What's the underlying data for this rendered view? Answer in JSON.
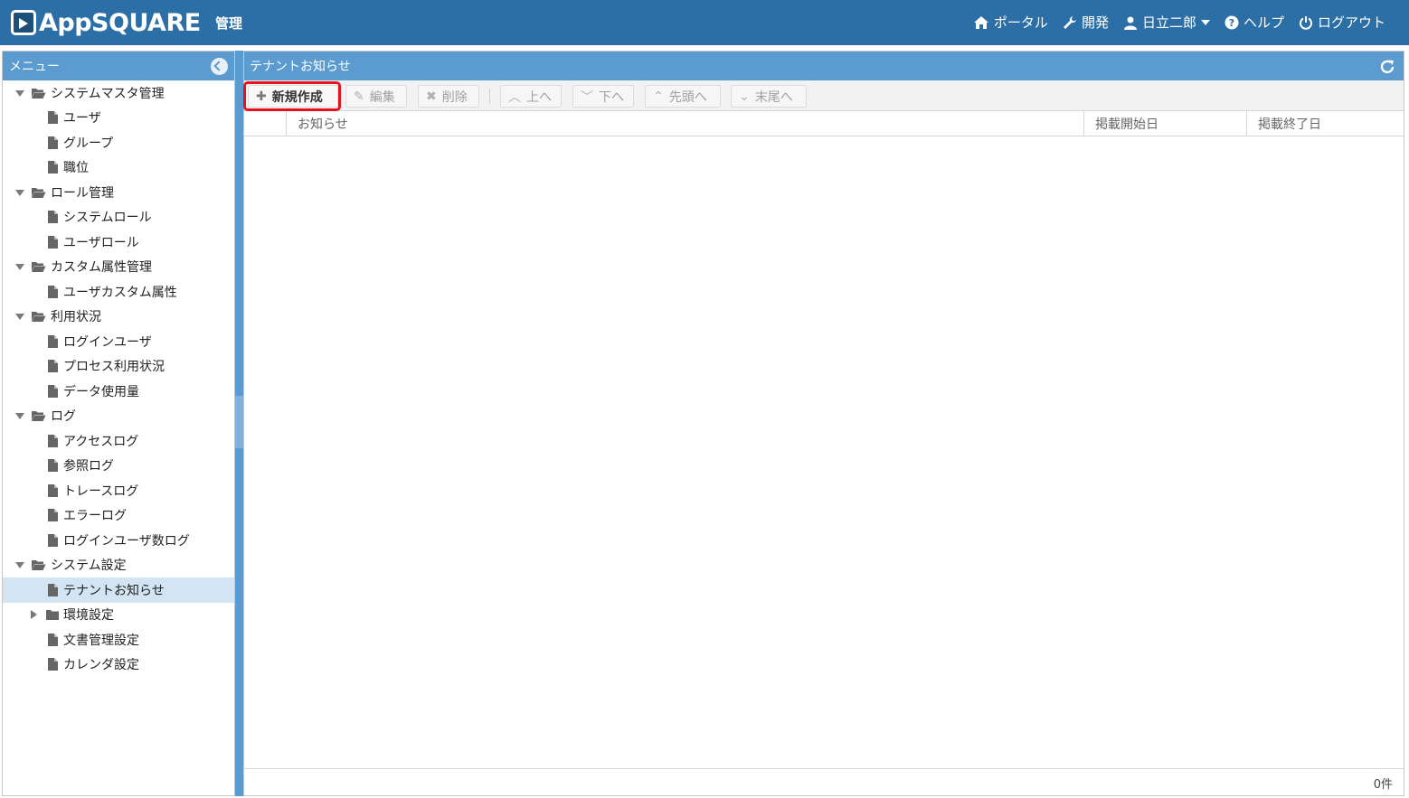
{
  "header": {
    "brand": "AppSQUARE",
    "section": "管理",
    "nav": [
      {
        "name": "portal",
        "label": "ポータル",
        "icon": "home-icon"
      },
      {
        "name": "develop",
        "label": "開発",
        "icon": "wrench-icon"
      },
      {
        "name": "user",
        "label": "日立二郎",
        "icon": "user-icon"
      },
      {
        "name": "help",
        "label": "ヘルプ",
        "icon": "help-icon"
      },
      {
        "name": "logout",
        "label": "ログアウト",
        "icon": "power-icon"
      }
    ],
    "bg_color": "#2b6fa6"
  },
  "sidebar": {
    "title": "メニュー",
    "tree": [
      {
        "label": "システムマスタ管理",
        "type": "folder",
        "expanded": true
      },
      {
        "label": "ユーザ",
        "type": "page"
      },
      {
        "label": "グループ",
        "type": "page"
      },
      {
        "label": "職位",
        "type": "page"
      },
      {
        "label": "ロール管理",
        "type": "folder",
        "expanded": true
      },
      {
        "label": "システムロール",
        "type": "page"
      },
      {
        "label": "ユーザロール",
        "type": "page"
      },
      {
        "label": "カスタム属性管理",
        "type": "folder",
        "expanded": true
      },
      {
        "label": "ユーザカスタム属性",
        "type": "page"
      },
      {
        "label": "利用状況",
        "type": "folder",
        "expanded": true
      },
      {
        "label": "ログインユーザ",
        "type": "page"
      },
      {
        "label": "プロセス利用状況",
        "type": "page"
      },
      {
        "label": "データ使用量",
        "type": "page"
      },
      {
        "label": "ログ",
        "type": "folder",
        "expanded": true
      },
      {
        "label": "アクセスログ",
        "type": "page"
      },
      {
        "label": "参照ログ",
        "type": "page"
      },
      {
        "label": "トレースログ",
        "type": "page"
      },
      {
        "label": "エラーログ",
        "type": "page"
      },
      {
        "label": "ログインユーザ数ログ",
        "type": "page"
      },
      {
        "label": "システム設定",
        "type": "folder",
        "expanded": true
      },
      {
        "label": "テナントお知らせ",
        "type": "page",
        "selected": true
      },
      {
        "label": "環境設定",
        "type": "folder",
        "expanded": false
      },
      {
        "label": "文書管理設定",
        "type": "page"
      },
      {
        "label": "カレンダ設定",
        "type": "page"
      }
    ]
  },
  "main": {
    "title": "テナントお知らせ",
    "toolbar": {
      "new": "新規作成",
      "edit": "編集",
      "delete": "削除",
      "up": "上へ",
      "down": "下へ",
      "top": "先頭へ",
      "bottom": "末尾へ"
    },
    "columns": [
      "お知らせ",
      "掲載開始日",
      "掲載終了日"
    ],
    "rows": [],
    "count": "0件"
  },
  "colors": {
    "panel_header": "#5b9bd0",
    "highlight": "#e3141d",
    "selected_row": "#d3e4f3"
  }
}
